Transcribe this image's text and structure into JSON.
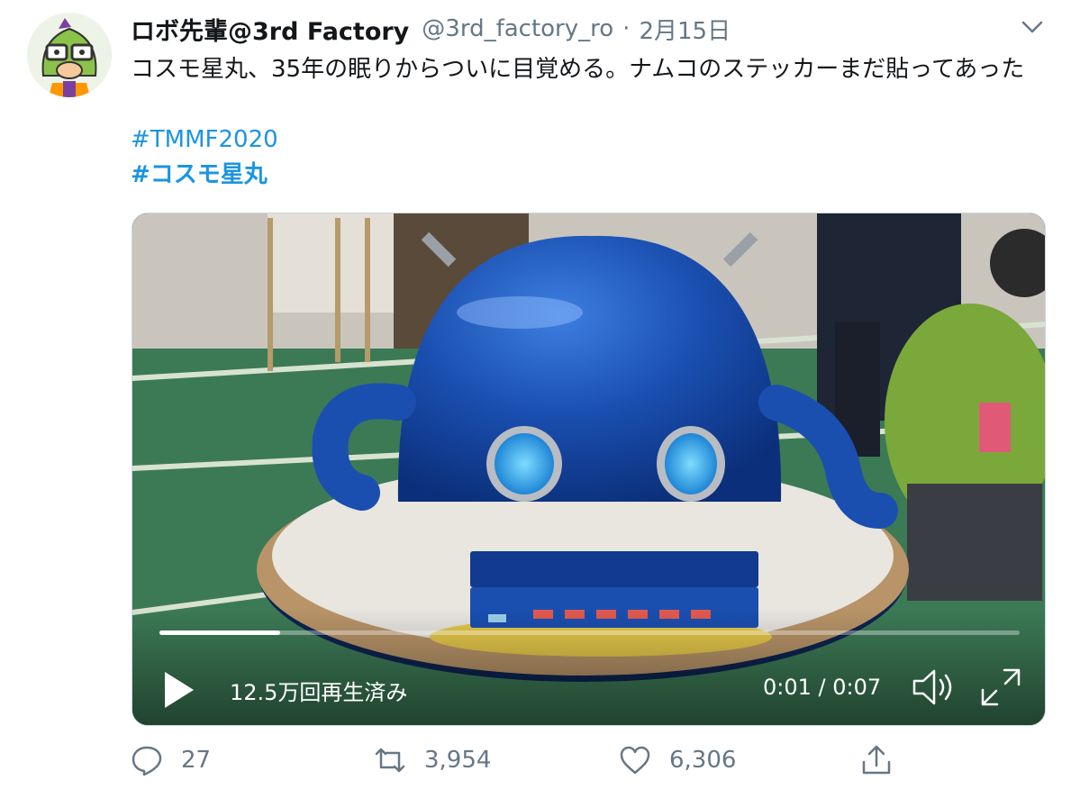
{
  "tweet": {
    "display_name": "ロボ先輩@3rd Factory",
    "handle": "@3rd_factory_ro",
    "separator": "·",
    "date": "2月15日",
    "text": "コスモ星丸、35年の眠りからついに目覚める。ナムコのステッカーまだ貼ってあった",
    "hashtags": [
      "#TMMF2020",
      "#コスモ星丸"
    ]
  },
  "video": {
    "views": "12.5万回再生済み",
    "current_time": "0:01",
    "duration": "0:07",
    "timecode": "0:01 / 0:07",
    "progress_fraction": 0.14
  },
  "actions": {
    "replies": "27",
    "retweets": "3,954",
    "likes": "6,306"
  },
  "colors": {
    "link": "#1b95e0",
    "muted": "#657786",
    "text": "#14171a"
  },
  "icons": [
    "avatar-character",
    "chevron-down-icon",
    "play-icon",
    "volume-icon",
    "fullscreen-icon",
    "reply-icon",
    "retweet-icon",
    "like-icon",
    "share-icon"
  ]
}
